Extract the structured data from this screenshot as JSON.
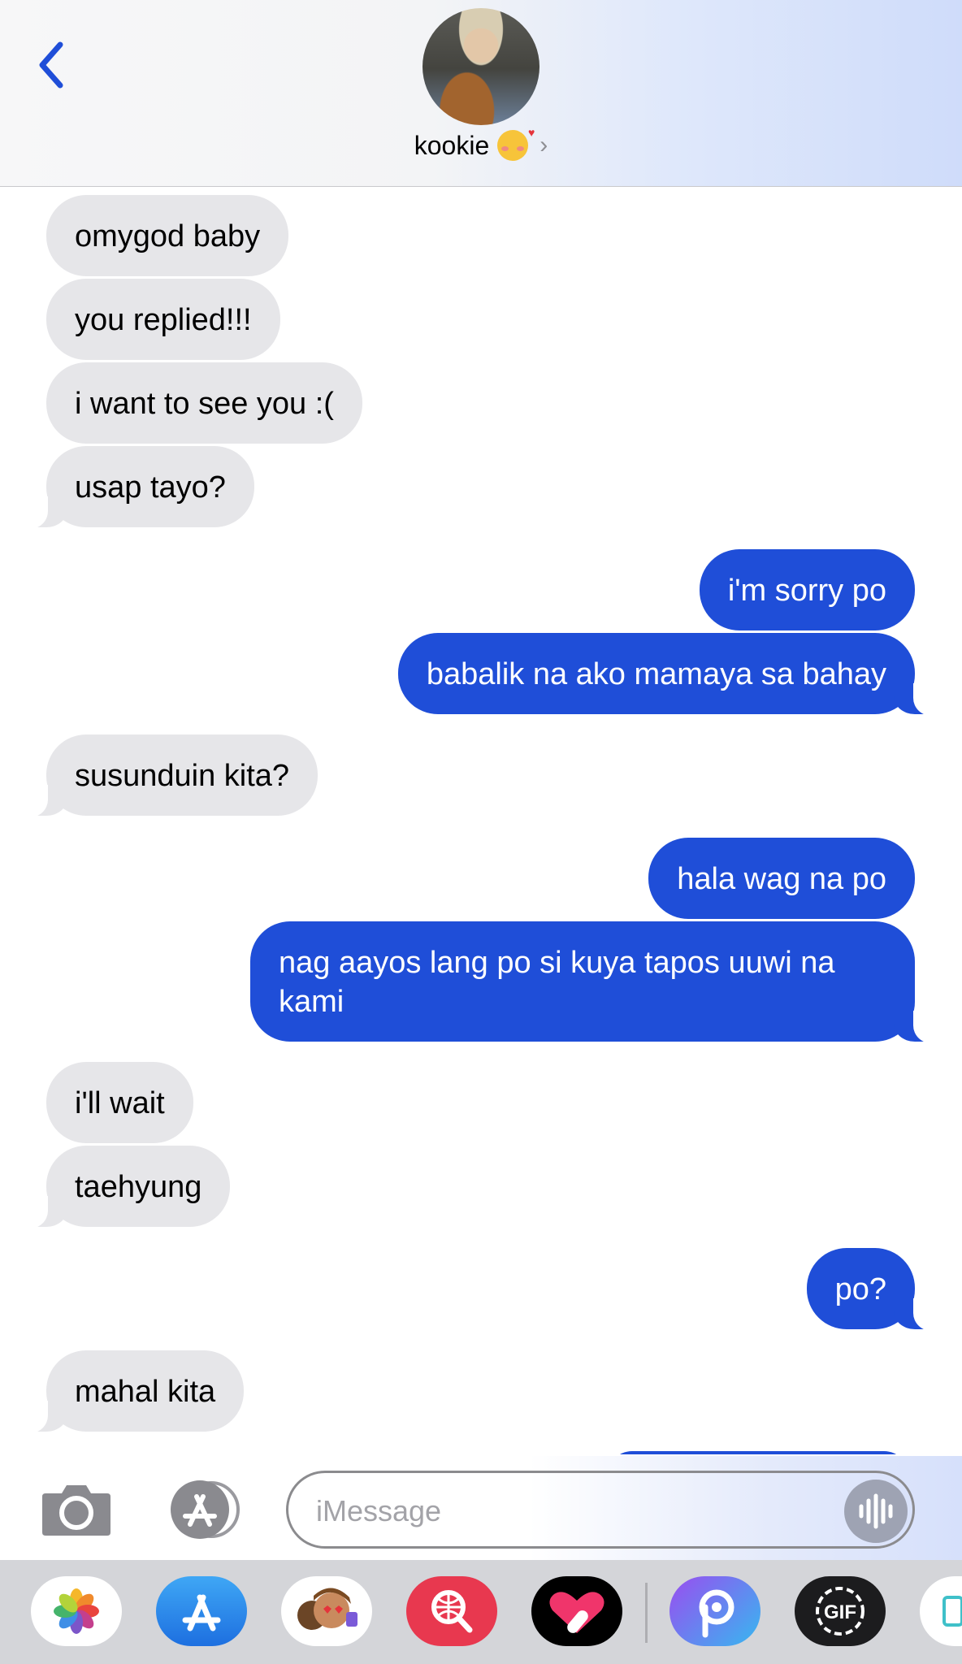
{
  "header": {
    "contact_name": "kookie",
    "contact_emoji": "smiling-face-with-hearts-emoji",
    "chevron": "›",
    "accent": "#1f4ed8"
  },
  "messages": [
    {
      "dir": "in",
      "text": "omygod baby"
    },
    {
      "dir": "in",
      "text": "you replied!!!"
    },
    {
      "dir": "in",
      "text": "i want to see you :("
    },
    {
      "dir": "in",
      "text": "usap tayo?"
    },
    {
      "dir": "out",
      "text": "i'm sorry po"
    },
    {
      "dir": "out",
      "text": "babalik na ako mamaya sa bahay"
    },
    {
      "dir": "in",
      "text": "susunduin kita?"
    },
    {
      "dir": "out",
      "text": "hala wag na po"
    },
    {
      "dir": "out",
      "text": "nag aayos lang po si kuya tapos uuwi na kami"
    },
    {
      "dir": "in",
      "text": "i'll wait"
    },
    {
      "dir": "in",
      "text": "taehyung"
    },
    {
      "dir": "out",
      "text": "po?"
    },
    {
      "dir": "in",
      "text": "mahal kita"
    }
  ],
  "compose": {
    "placeholder": "iMessage",
    "value": ""
  },
  "app_drawer": {
    "items": [
      "photos-icon",
      "app-store-icon",
      "memoji-icon",
      "web-search-icon",
      "digital-touch-icon",
      "picsart-icon",
      "gif-icon",
      "more-apps-icon"
    ]
  },
  "colors": {
    "incoming_bubble": "#e6e6e9",
    "outgoing_bubble": "#1f4ed8",
    "drawer_bg": "#d4d5d9"
  }
}
